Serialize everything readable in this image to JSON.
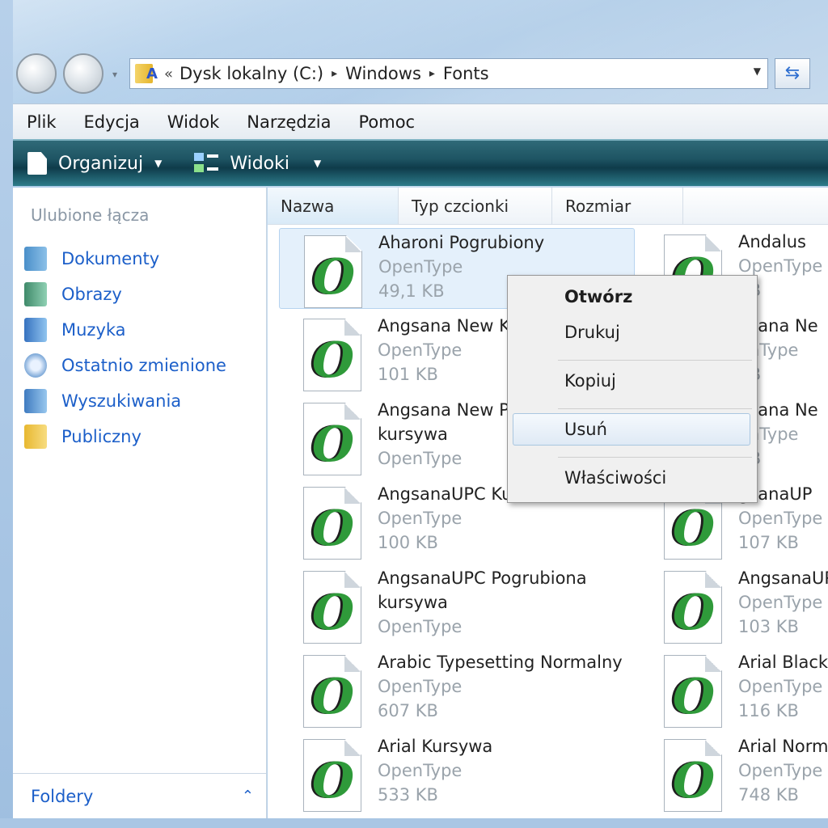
{
  "navigation": {
    "address_root_chevron": "«",
    "breadcrumbs": [
      "Dysk lokalny (C:)",
      "Windows",
      "Fonts"
    ],
    "separator": "▸"
  },
  "menubar": [
    "Plik",
    "Edycja",
    "Widok",
    "Narzędzia",
    "Pomoc"
  ],
  "toolbar": {
    "organize_label": "Organizuj",
    "views_label": "Widoki"
  },
  "sidebar": {
    "title": "Ulubione łącza",
    "items": [
      {
        "label": "Dokumenty",
        "icon": "documents-icon"
      },
      {
        "label": "Obrazy",
        "icon": "pictures-icon"
      },
      {
        "label": "Muzyka",
        "icon": "music-icon"
      },
      {
        "label": "Ostatnio zmienione",
        "icon": "recent-icon"
      },
      {
        "label": "Wyszukiwania",
        "icon": "searches-icon"
      },
      {
        "label": "Publiczny",
        "icon": "public-folder-icon"
      }
    ],
    "folders_label": "Foldery",
    "folders_chevron": "⌃"
  },
  "columns": [
    "Nazwa",
    "Typ czcionki",
    "Rozmiar"
  ],
  "font_glyph": "O",
  "fonts": [
    {
      "name": "Aharoni Pogrubiony",
      "type": "OpenType",
      "size": "49,1 KB",
      "selected": true
    },
    {
      "name": "Andalus",
      "type": "OpenType",
      "size": "KB"
    },
    {
      "name": "Angsana New Ku",
      "type": "OpenType",
      "size": "101 KB"
    },
    {
      "name": "gsana Ne",
      "type": "enType",
      "size": "KB"
    },
    {
      "name": "Angsana New Po",
      "name2": "kursywa",
      "type": "OpenType",
      "size": ""
    },
    {
      "name": "gsana Ne",
      "type": "enType",
      "size": "KB"
    },
    {
      "name": "AngsanaUPC Ku",
      "type": "OpenType",
      "size": "100 KB"
    },
    {
      "name": "gsanaUP",
      "type": "OpenType",
      "size": "107 KB"
    },
    {
      "name": "AngsanaUPC Pogrubiona",
      "name2": "kursywa",
      "type": "OpenType",
      "size": ""
    },
    {
      "name": "AngsanaUPC",
      "type": "OpenType",
      "size": "103 KB"
    },
    {
      "name": "Arabic Typesetting Normalny",
      "type": "OpenType",
      "size": "607 KB"
    },
    {
      "name": "Arial Black N",
      "type": "OpenType",
      "size": "116 KB"
    },
    {
      "name": "Arial Kursywa",
      "type": "OpenType",
      "size": "533 KB"
    },
    {
      "name": "Arial Norma",
      "type": "OpenType",
      "size": "748 KB"
    }
  ],
  "context_menu": {
    "items": [
      "Otwórz",
      "Drukuj",
      "Kopiuj",
      "Usuń",
      "Właściwości"
    ],
    "highlighted": "Usuń"
  }
}
